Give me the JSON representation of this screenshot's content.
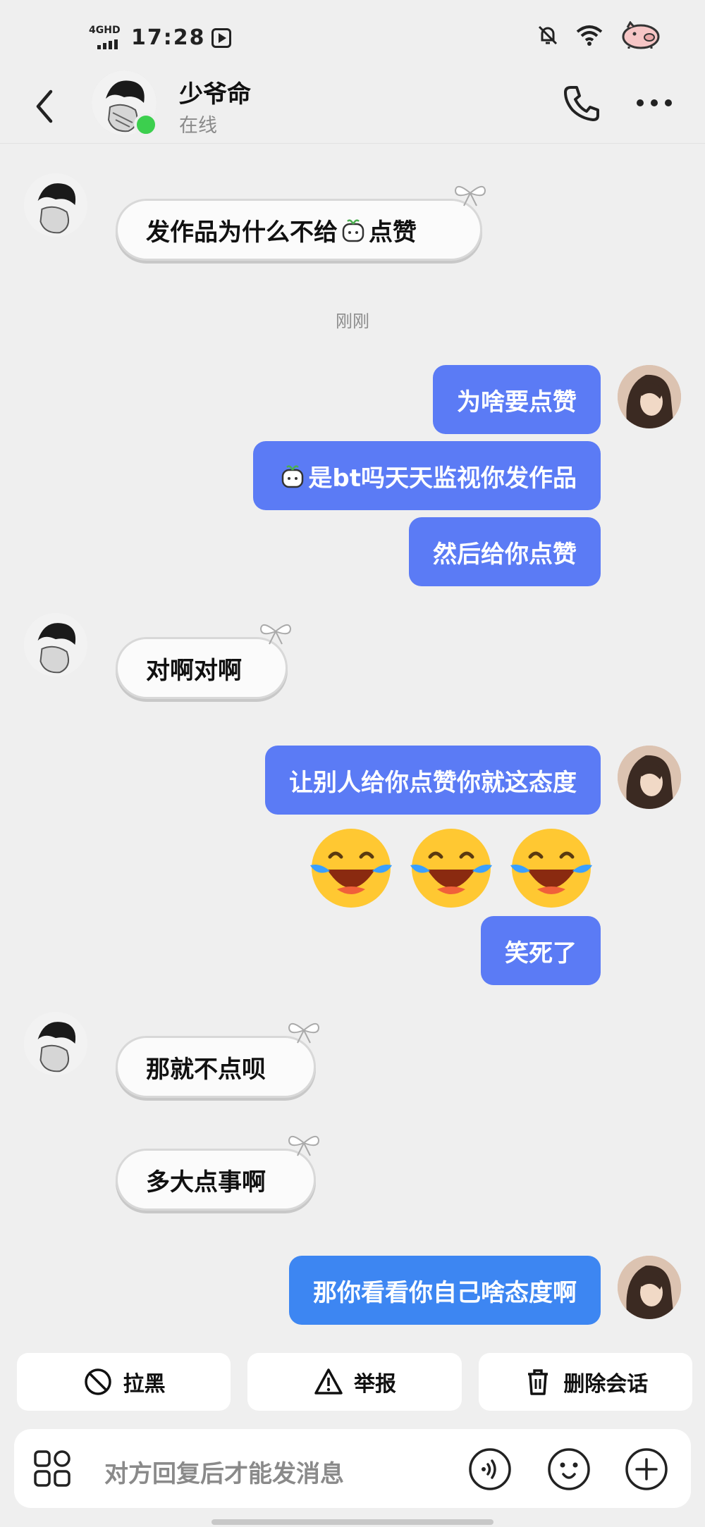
{
  "status_bar": {
    "network": "4GHD",
    "time": "17:28"
  },
  "header": {
    "contact_name": "少爷命",
    "contact_status": "在线"
  },
  "timestamp": "刚刚",
  "messages": {
    "m1": {
      "text_before": "发作品为什么不给",
      "text_after": "点赞"
    },
    "m2": {
      "text": "为啥要点赞"
    },
    "m3": {
      "text": "是bt吗天天监视你发作品"
    },
    "m4": {
      "text": "然后给你点赞"
    },
    "m5": {
      "text": "对啊对啊"
    },
    "m6": {
      "text": "让别人给你点赞你就这态度"
    },
    "m8": {
      "text": "笑死了"
    },
    "m9": {
      "text": "那就不点呗"
    },
    "m10": {
      "text": "多大点事啊"
    },
    "m11": {
      "text": "那你看看你自己啥态度啊"
    }
  },
  "actions": {
    "block": "拉黑",
    "report": "举报",
    "delete": "删除会话"
  },
  "input": {
    "placeholder": "对方回复后才能发消息"
  },
  "colors": {
    "bubble_me": "#5b7bf5",
    "bubble_me_alt": "#3d86f2",
    "online": "#3ccf4e",
    "background": "#efefef"
  }
}
